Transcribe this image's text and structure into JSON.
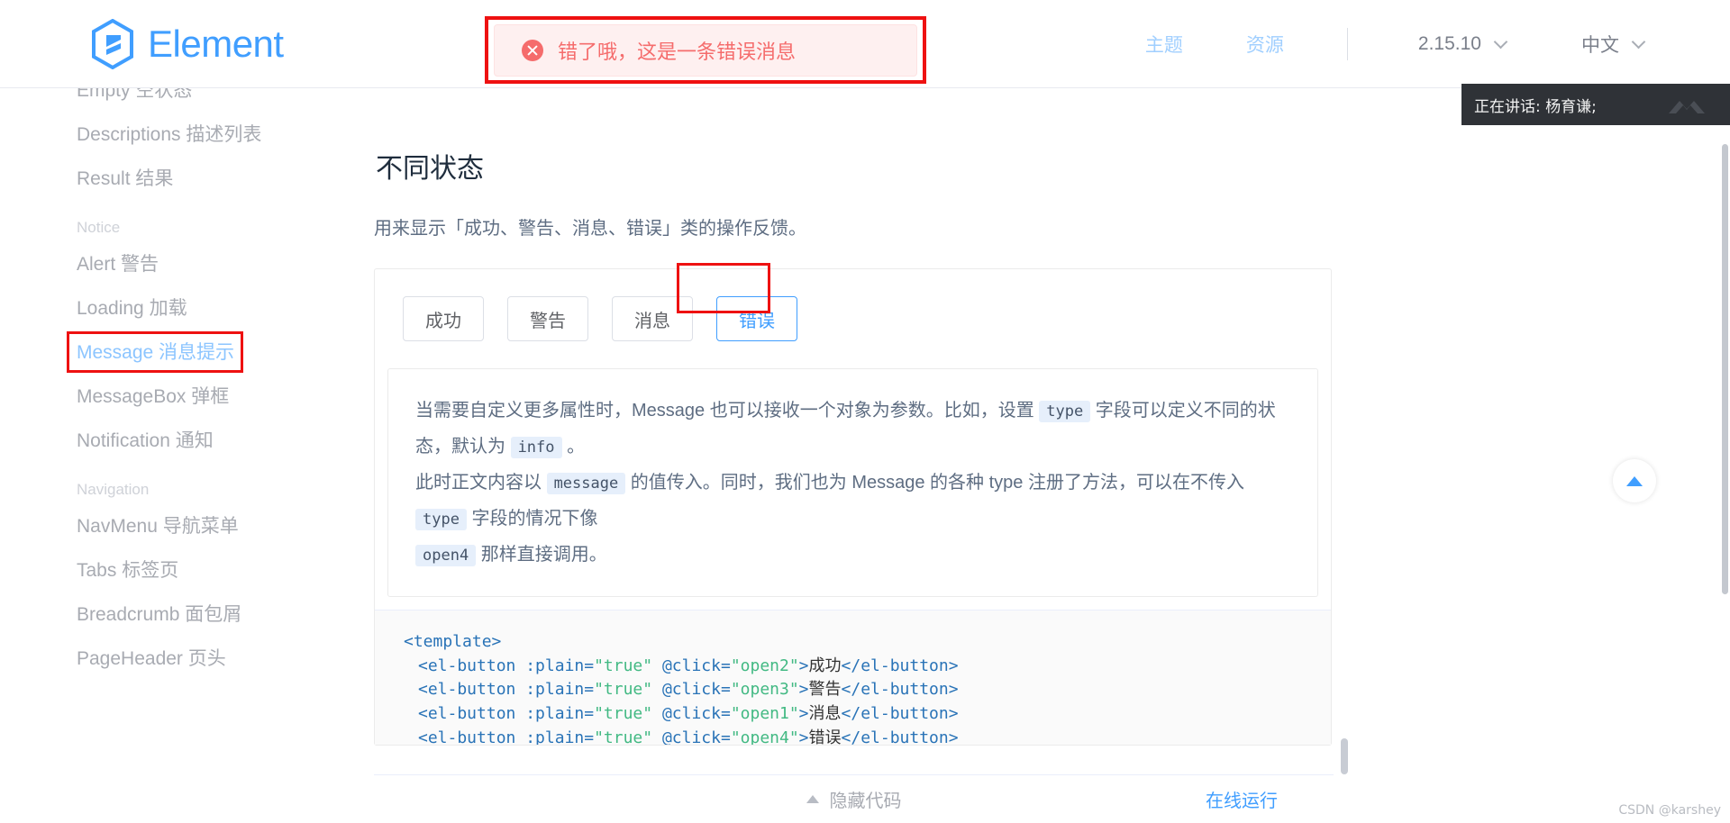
{
  "header": {
    "brand": "Element",
    "nav_links": [
      "主题",
      "资源"
    ],
    "version": "2.15.10",
    "language": "中文"
  },
  "toast": {
    "icon": "error-circle-icon",
    "message": "错了哦，这是一条错误消息",
    "accent": "#f56c6c",
    "background": "#fef0f0"
  },
  "speaking_overlay": {
    "text": "正在讲话: 杨育谦;"
  },
  "sidebar": {
    "items": [
      {
        "label": "Empty 空状态",
        "type": "item",
        "active": false
      },
      {
        "label": "Descriptions 描述列表",
        "type": "item",
        "active": false
      },
      {
        "label": "Result 结果",
        "type": "item",
        "active": false
      },
      {
        "label": "Notice",
        "type": "group"
      },
      {
        "label": "Alert 警告",
        "type": "item",
        "active": false
      },
      {
        "label": "Loading 加载",
        "type": "item",
        "active": false
      },
      {
        "label": "Message 消息提示",
        "type": "item",
        "active": true
      },
      {
        "label": "MessageBox 弹框",
        "type": "item",
        "active": false
      },
      {
        "label": "Notification 通知",
        "type": "item",
        "active": false
      },
      {
        "label": "Navigation",
        "type": "group"
      },
      {
        "label": "NavMenu 导航菜单",
        "type": "item",
        "active": false
      },
      {
        "label": "Tabs 标签页",
        "type": "item",
        "active": false
      },
      {
        "label": "Breadcrumb 面包屑",
        "type": "item",
        "active": false
      },
      {
        "label": "PageHeader 页头",
        "type": "item",
        "active": false
      }
    ]
  },
  "main": {
    "heading": "不同状态",
    "intro": "用来显示「成功、警告、消息、错误」类的操作反馈。",
    "demo_buttons": [
      {
        "label": "成功",
        "focused": false
      },
      {
        "label": "警告",
        "focused": false
      },
      {
        "label": "消息",
        "focused": false
      },
      {
        "label": "错误",
        "focused": true
      }
    ],
    "description": {
      "p1_a": "当需要自定义更多属性时，Message 也可以接收一个对象为参数。比如，设置 ",
      "code1": "type",
      "p1_b": " 字段可以定义不同的状态，默认为 ",
      "code2": "info",
      "p1_c": " 。",
      "p2_a": "此时正文内容以 ",
      "code3": "message",
      "p2_b": " 的值传入。同时，我们也为 Message 的各种 type 注册了方法，可以在不传入 ",
      "code4": "type",
      "p2_c": " 字段的情况下像",
      "p3_a": "",
      "code5": "open4",
      "p3_b": " 那样直接调用。"
    },
    "code_lines": [
      {
        "parts": [
          {
            "t": "<template>",
            "c": "tk-tag"
          }
        ],
        "indent": 0
      },
      {
        "parts": [
          {
            "t": "<el-button ",
            "c": "tk-tag"
          },
          {
            "t": ":plain=",
            "c": "tk-attr"
          },
          {
            "t": "\"true\"",
            "c": "tk-str"
          },
          {
            "t": " @click=",
            "c": "tk-attr"
          },
          {
            "t": "\"open2\"",
            "c": "tk-str"
          },
          {
            "t": ">",
            "c": "tk-tag"
          },
          {
            "t": "成功",
            "c": "tk-text"
          },
          {
            "t": "</el-button>",
            "c": "tk-tag"
          }
        ],
        "indent": 1
      },
      {
        "parts": [
          {
            "t": "<el-button ",
            "c": "tk-tag"
          },
          {
            "t": ":plain=",
            "c": "tk-attr"
          },
          {
            "t": "\"true\"",
            "c": "tk-str"
          },
          {
            "t": " @click=",
            "c": "tk-attr"
          },
          {
            "t": "\"open3\"",
            "c": "tk-str"
          },
          {
            "t": ">",
            "c": "tk-tag"
          },
          {
            "t": "警告",
            "c": "tk-text"
          },
          {
            "t": "</el-button>",
            "c": "tk-tag"
          }
        ],
        "indent": 1
      },
      {
        "parts": [
          {
            "t": "<el-button ",
            "c": "tk-tag"
          },
          {
            "t": ":plain=",
            "c": "tk-attr"
          },
          {
            "t": "\"true\"",
            "c": "tk-str"
          },
          {
            "t": " @click=",
            "c": "tk-attr"
          },
          {
            "t": "\"open1\"",
            "c": "tk-str"
          },
          {
            "t": ">",
            "c": "tk-tag"
          },
          {
            "t": "消息",
            "c": "tk-text"
          },
          {
            "t": "</el-button>",
            "c": "tk-tag"
          }
        ],
        "indent": 1
      },
      {
        "parts": [
          {
            "t": "<el-button ",
            "c": "tk-tag"
          },
          {
            "t": ":plain=",
            "c": "tk-attr"
          },
          {
            "t": "\"true\"",
            "c": "tk-str"
          },
          {
            "t": " @click=",
            "c": "tk-attr"
          },
          {
            "t": "\"open4\"",
            "c": "tk-str"
          },
          {
            "t": ">",
            "c": "tk-tag"
          },
          {
            "t": "错误",
            "c": "tk-text"
          },
          {
            "t": "</el-button>",
            "c": "tk-tag"
          }
        ],
        "indent": 1
      }
    ],
    "hide_code_label": "隐藏代码",
    "run_online_label": "在线运行"
  },
  "watermark": "CSDN @karshey"
}
